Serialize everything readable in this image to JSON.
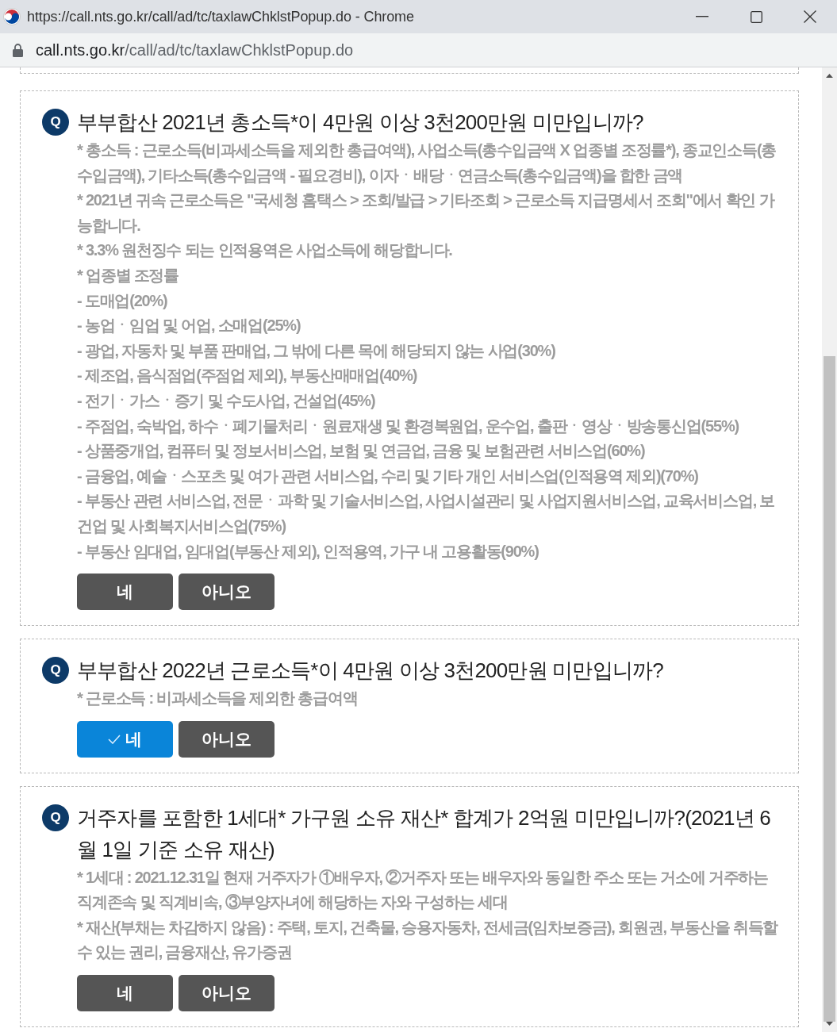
{
  "window": {
    "title": "https://call.nts.go.kr/call/ad/tc/taxlawChklstPopup.do - Chrome"
  },
  "address_bar": {
    "host": "call.nts.go.kr",
    "path": "/call/ad/tc/taxlawChklstPopup.do"
  },
  "questions": [
    {
      "marker": "Q",
      "text": "부부합산 2021년 총소득*이 4만원 이상 3천200만원 미만입니까?",
      "notes": [
        "* 총소득 : 근로소득(비과세소득을 제외한 총급여액), 사업소득(총수입금액 X 업종별 조정률*), 종교인소득(총수입금액), 기타소득(총수입금액 - 필요경비), 이자ㆍ배당ㆍ연금소득(총수입금액)을 합한 금액",
        "* 2021년 귀속 근로소득은 \"국세청 홈택스 > 조회/발급 > 기타조회 > 근로소득 지급명세서 조회\"에서 확인 가능합니다.",
        "* 3.3% 원천징수 되는 인적용역은 사업소득에 해당합니다.",
        "* 업종별 조정률",
        "- 도매업(20%)",
        "- 농업ㆍ임업 및 어업, 소매업(25%)",
        "- 광업, 자동차 및 부품 판매업, 그 밖에 다른 목에 해당되지 않는 사업(30%)",
        "- 제조업, 음식점업(주점업 제외), 부동산매매업(40%)",
        "- 전기ㆍ가스ㆍ증기 및 수도사업, 건설업(45%)",
        "- 주점업, 숙박업, 하수ㆍ폐기물처리ㆍ원료재생 및 환경복원업, 운수업, 출판ㆍ영상ㆍ방송통신업(55%)",
        "- 상품중개업, 컴퓨터 및 정보서비스업, 보험 및 연금업, 금융 및 보험관련 서비스업(60%)",
        "- 금융업, 예술ㆍ스포츠 및 여가 관련 서비스업, 수리 및 기타 개인 서비스업(인적용역 제외)(70%)",
        "- 부동산 관련 서비스업, 전문ㆍ과학 및 기술서비스업, 사업시설관리 및 사업지원서비스업, 교육서비스업, 보건업 및 사회복지서비스업(75%)",
        "- 부동산 임대업, 임대업(부동산 제외), 인적용역, 가구 내 고용활동(90%)"
      ],
      "answers": [
        {
          "label": "네",
          "selected": false
        },
        {
          "label": "아니오",
          "selected": false
        }
      ]
    },
    {
      "marker": "Q",
      "text": "부부합산 2022년 근로소득*이 4만원 이상 3천200만원 미만입니까?",
      "notes": [
        "* 근로소득 : 비과세소득을 제외한 총급여액"
      ],
      "answers": [
        {
          "label": "네",
          "selected": true
        },
        {
          "label": "아니오",
          "selected": false
        }
      ]
    },
    {
      "marker": "Q",
      "text": "거주자를 포함한 1세대* 가구원 소유 재산* 합계가 2억원 미만입니까?(2021년 6월 1일 기준 소유 재산)",
      "notes": [
        "* 1세대 : 2021.12.31일 현재 거주자가 ①배우자, ②거주자 또는 배우자와 동일한 주소 또는 거소에 거주하는 직계존속 및 직계비속, ③부양자녀에 해당하는 자와 구성하는 세대",
        "* 재산(부채는 차감하지 않음) : 주택, 토지, 건축물, 승용자동차, 전세금(임차보증금), 회원권, 부동산을 취득할 수 있는 권리, 금융재산, 유가증권"
      ],
      "answers": [
        {
          "label": "네",
          "selected": false
        },
        {
          "label": "아니오",
          "selected": false
        }
      ]
    }
  ]
}
